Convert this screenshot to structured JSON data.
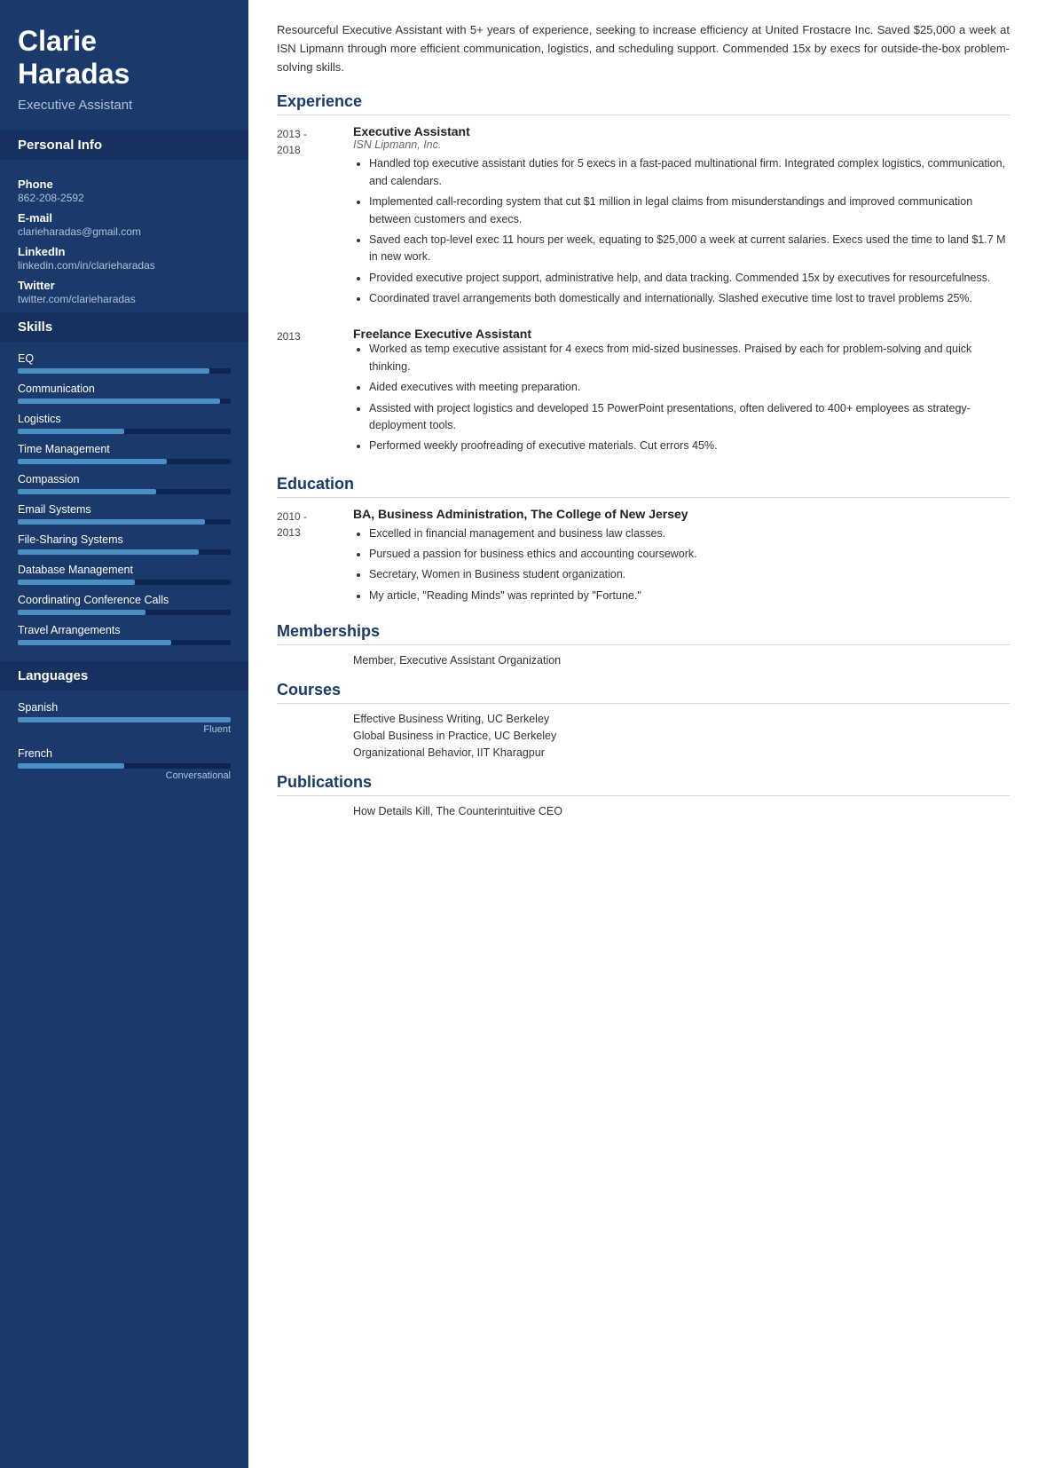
{
  "sidebar": {
    "name": "Clarie\nHaradas",
    "title": "Executive Assistant",
    "personal_info_label": "Personal Info",
    "phone_label": "Phone",
    "phone_value": "862-208-2592",
    "email_label": "E-mail",
    "email_value": "clarieharadas@gmail.com",
    "linkedin_label": "LinkedIn",
    "linkedin_value": "linkedin.com/in/clarieharadas",
    "twitter_label": "Twitter",
    "twitter_value": "twitter.com/clarieharadas",
    "skills_label": "Skills",
    "skills": [
      {
        "name": "EQ",
        "pct": 90
      },
      {
        "name": "Communication",
        "pct": 95
      },
      {
        "name": "Logistics",
        "pct": 50
      },
      {
        "name": "Time Management",
        "pct": 70
      },
      {
        "name": "Compassion",
        "pct": 65
      },
      {
        "name": "Email Systems",
        "pct": 88
      },
      {
        "name": "File-Sharing Systems",
        "pct": 85
      },
      {
        "name": "Database Management",
        "pct": 55
      },
      {
        "name": "Coordinating Conference Calls",
        "pct": 60
      },
      {
        "name": "Travel Arrangements",
        "pct": 72
      }
    ],
    "languages_label": "Languages",
    "languages": [
      {
        "name": "Spanish",
        "pct": 100,
        "level": "Fluent"
      },
      {
        "name": "French",
        "pct": 50,
        "level": "Conversational"
      }
    ]
  },
  "main": {
    "summary": "Resourceful Executive Assistant with 5+ years of experience, seeking to increase efficiency at United Frostacre Inc. Saved $25,000 a week at ISN Lipmann through more efficient communication, logistics, and scheduling support. Commended 15x by execs for outside-the-box problem-solving skills.",
    "experience_label": "Experience",
    "experience": [
      {
        "dates": "2013 -\n2018",
        "job_title": "Executive Assistant",
        "company": "ISN Lipmann, Inc.",
        "bullets": [
          "Handled top executive assistant duties for 5 execs in a fast-paced multinational firm. Integrated complex logistics, communication, and calendars.",
          "Implemented call-recording system that cut $1 million in legal claims from misunderstandings and improved communication between customers and execs.",
          "Saved each top-level exec 11 hours per week, equating to $25,000 a week at current salaries. Execs used the time to land $1.7 M in new work.",
          "Provided executive project support, administrative help, and data tracking. Commended 15x by executives for resourcefulness.",
          "Coordinated travel arrangements both domestically and internationally. Slashed executive time lost to travel problems 25%."
        ]
      },
      {
        "dates": "2013",
        "job_title": "Freelance Executive Assistant",
        "company": "",
        "bullets": [
          "Worked as temp executive assistant for 4 execs from mid-sized businesses. Praised by each for problem-solving and quick thinking.",
          "Aided executives with meeting preparation.",
          "Assisted with project logistics and developed 15 PowerPoint presentations, often delivered to 400+ employees as strategy-deployment tools.",
          "Performed weekly proofreading of executive materials. Cut errors 45%."
        ]
      }
    ],
    "education_label": "Education",
    "education": [
      {
        "dates": "2010 -\n2013",
        "degree": "BA, Business Administration, The College of New Jersey",
        "bullets": [
          "Excelled in financial management and business law classes.",
          "Pursued a passion for business ethics and accounting coursework.",
          "Secretary, Women in Business student organization.",
          "My article, \"Reading Minds\" was reprinted by \"Fortune.\""
        ]
      }
    ],
    "memberships_label": "Memberships",
    "memberships": [
      "Member, Executive Assistant Organization"
    ],
    "courses_label": "Courses",
    "courses": [
      "Effective Business Writing, UC Berkeley",
      "Global Business in Practice, UC Berkeley",
      "Organizational Behavior, IIT Kharagpur"
    ],
    "publications_label": "Publications",
    "publications": [
      "How Details Kill, The Counterintuitive CEO"
    ]
  }
}
